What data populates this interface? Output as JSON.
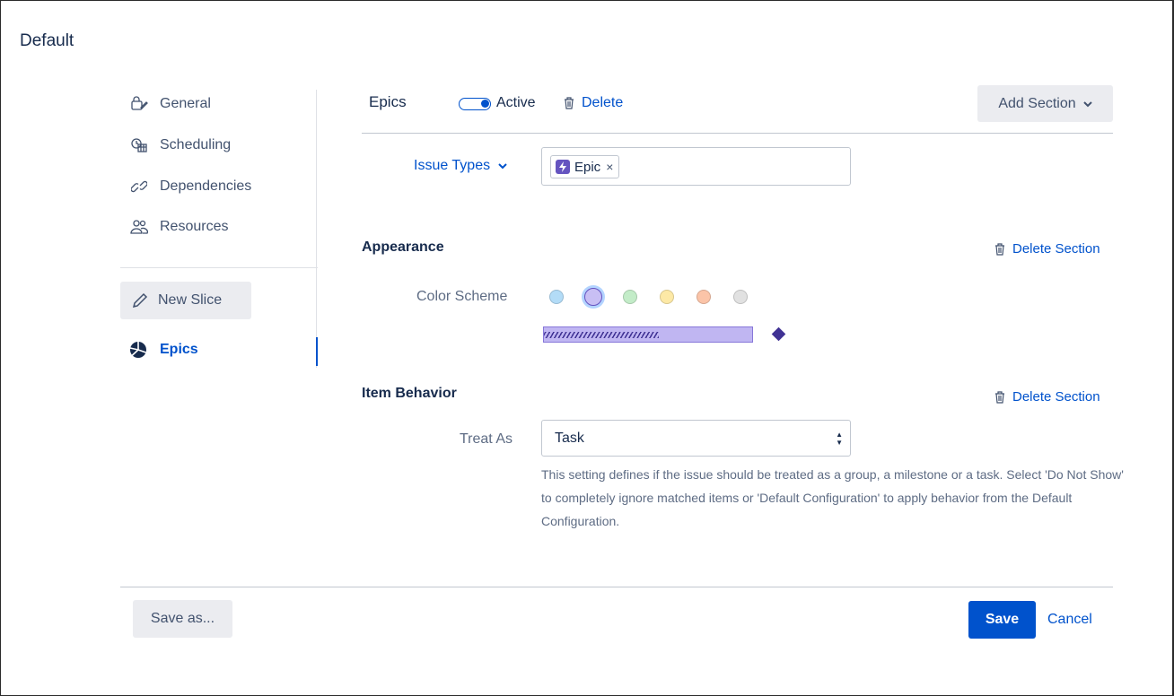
{
  "page": {
    "title": "Default"
  },
  "sidebar": {
    "items": [
      {
        "label": "General",
        "icon": "general-settings-icon"
      },
      {
        "label": "Scheduling",
        "icon": "scheduling-icon"
      },
      {
        "label": "Dependencies",
        "icon": "link-icon"
      },
      {
        "label": "Resources",
        "icon": "people-icon"
      }
    ],
    "new_slice_label": "New Slice",
    "active_slice": {
      "label": "Epics",
      "icon": "pie-chart-icon",
      "color": "#0052cc"
    }
  },
  "header": {
    "title": "Epics",
    "toggle_label": "Active",
    "toggle_on": true,
    "delete_label": "Delete",
    "add_section_label": "Add Section"
  },
  "issue_types": {
    "label": "Issue Types",
    "chips": [
      {
        "label": "Epic",
        "icon": "epic-lightning-icon",
        "color": "#6554c0"
      }
    ]
  },
  "appearance": {
    "title": "Appearance",
    "delete_label": "Delete Section",
    "color_scheme_label": "Color Scheme",
    "swatches": [
      {
        "name": "blue",
        "color": "#b3dcf7",
        "selected": false
      },
      {
        "name": "purple",
        "color": "#c8bff4",
        "selected": true
      },
      {
        "name": "green",
        "color": "#c3ecc8",
        "selected": false
      },
      {
        "name": "yellow",
        "color": "#fde9a6",
        "selected": false
      },
      {
        "name": "orange",
        "color": "#fbc4a8",
        "selected": false
      },
      {
        "name": "gray",
        "color": "#e1e1e1",
        "selected": false
      }
    ],
    "preview": {
      "bar_color": "#c0b6f2",
      "progress": 0.55,
      "milestone_color": "#403294"
    }
  },
  "item_behavior": {
    "title": "Item Behavior",
    "delete_label": "Delete Section",
    "treat_as_label": "Treat As",
    "treat_as_value": "Task",
    "help_text": "This setting defines if the issue should be treated as a group, a milestone or a task. Select 'Do Not Show' to completely ignore matched items or 'Default Configuration' to apply behavior from the Default Configuration."
  },
  "footer": {
    "save_as_label": "Save as...",
    "save_label": "Save",
    "cancel_label": "Cancel"
  },
  "colors": {
    "accent": "#0052cc",
    "text": "#172b4d",
    "muted": "#5e6c84"
  }
}
